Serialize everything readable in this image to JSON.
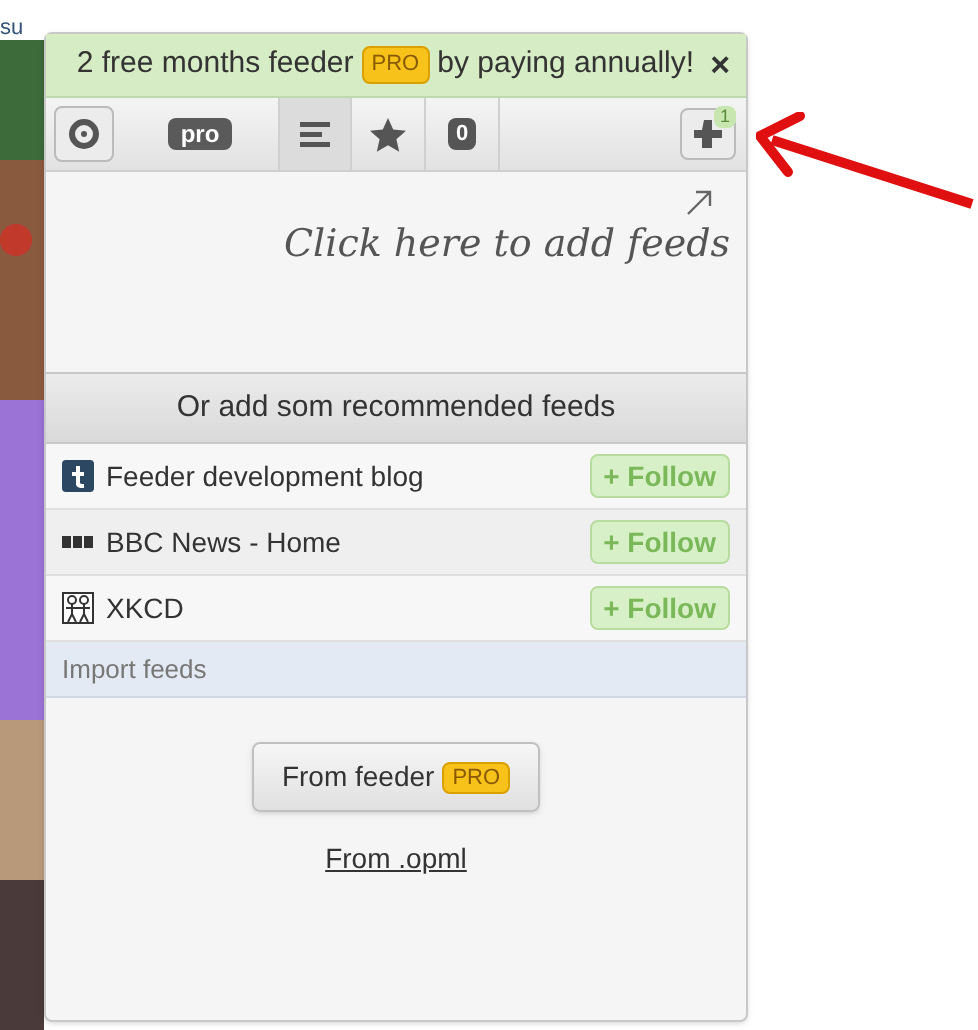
{
  "page_fragment": "su",
  "banner": {
    "text_before": "2 free months feeder",
    "badge": "PRO",
    "text_after": "by paying annually!",
    "close": "×"
  },
  "toolbar": {
    "pro_label": "pro",
    "tabs": [
      {
        "kind": "list",
        "selected": true
      },
      {
        "kind": "star",
        "selected": false
      },
      {
        "kind": "count",
        "label": "0",
        "selected": false
      }
    ],
    "add_badge": "1"
  },
  "hint": "Click here to add feeds",
  "recommended": {
    "heading": "Or add som recommended feeds",
    "feeds": [
      {
        "kind": "tumblr",
        "title": "Feeder development blog",
        "action": "+ Follow"
      },
      {
        "kind": "bbc",
        "title": "BBC News - Home",
        "action": "+ Follow"
      },
      {
        "kind": "xkcd",
        "title": "XKCD",
        "action": "+ Follow"
      }
    ]
  },
  "import": {
    "heading": "Import feeds",
    "button": "From feeder",
    "button_badge": "PRO",
    "link": "From .opml"
  }
}
